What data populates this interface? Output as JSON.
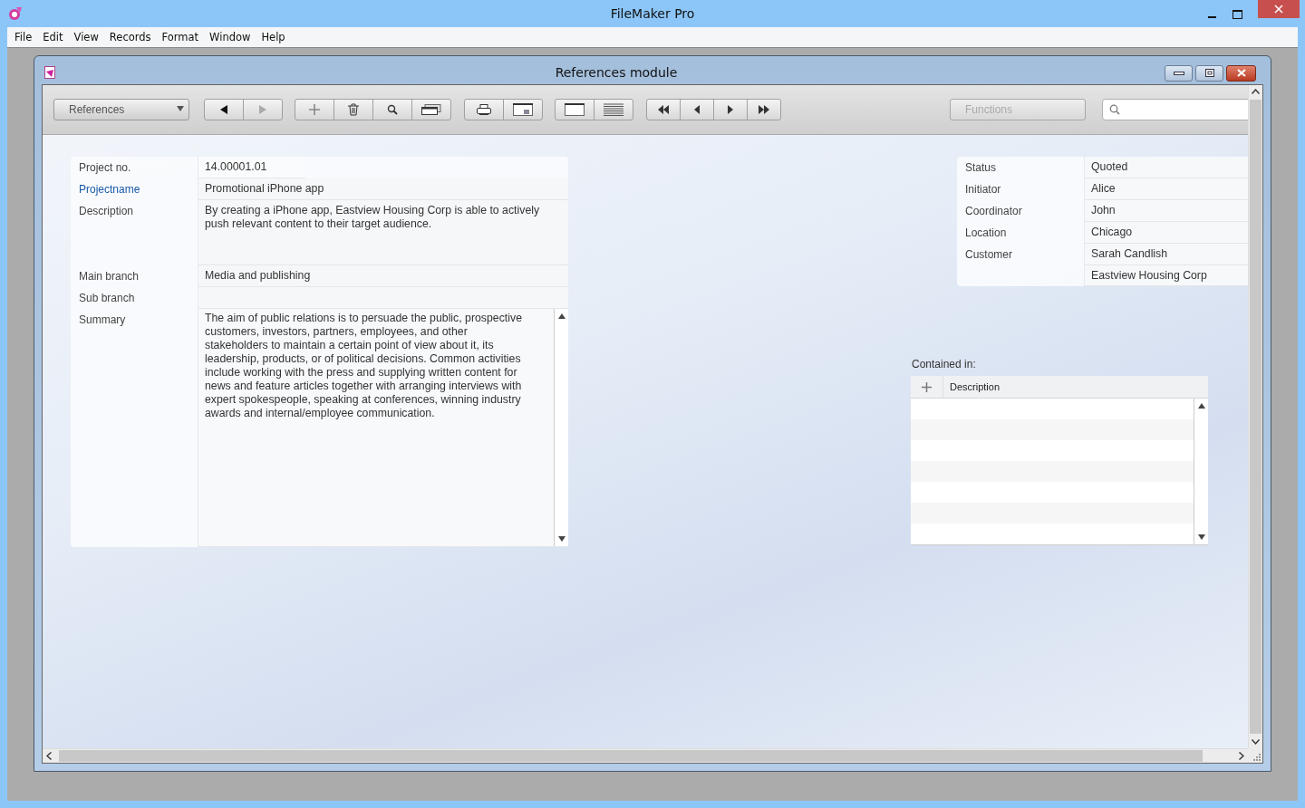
{
  "app_window": {
    "title": "FileMaker Pro"
  },
  "menu_bar": [
    "File",
    "Edit",
    "View",
    "Records",
    "Format",
    "Window",
    "Help"
  ],
  "document_window": {
    "title": "References module"
  },
  "toolbar": {
    "layout_menu": "References",
    "back_disabled": false,
    "forward_disabled": true,
    "functions_button": {
      "label": "Functions",
      "disabled": true
    }
  },
  "left_fields": [
    {
      "label": "Project no.",
      "value": "14.00001.01",
      "kind": "short",
      "highlighted": false
    },
    {
      "label": "Projectname",
      "value": "Promotional iPhone app",
      "kind": "line",
      "highlighted": true
    },
    {
      "label": "Description",
      "value": "By creating a iPhone app, Eastview Housing Corp is able to actively push relevant content to their target audience.",
      "kind": "tall",
      "highlighted": false
    },
    {
      "label": "Main branch",
      "value": "Media and publishing",
      "kind": "line",
      "highlighted": false
    },
    {
      "label": "Sub branch",
      "kind": "line",
      "highlighted": false
    },
    {
      "label": "Summary",
      "value": "The aim of public relations is to persuade the public, prospective customers, investors, partners, employees, and other stakeholders to maintain a certain point of view about it, its leadership, products, or of political decisions. Common activities include working with the press and supplying written content for news and feature articles together with arranging interviews with expert spokespeople, speaking at conferences, winning industry awards and internal/employee communication.",
      "kind": "scroll",
      "highlighted": false
    }
  ],
  "right_fields": [
    {
      "label": "Status",
      "value": "Quoted"
    },
    {
      "label": "Initiator",
      "value": "Alice"
    },
    {
      "label": "Coordinator",
      "value": "John"
    },
    {
      "label": "Location",
      "value": "Chicago"
    },
    {
      "label": "Customer",
      "value": "Sarah Candlish"
    },
    {
      "value": "Eastview Housing Corp"
    }
  ],
  "portal": {
    "label": "Contained in:",
    "column": "Description"
  }
}
